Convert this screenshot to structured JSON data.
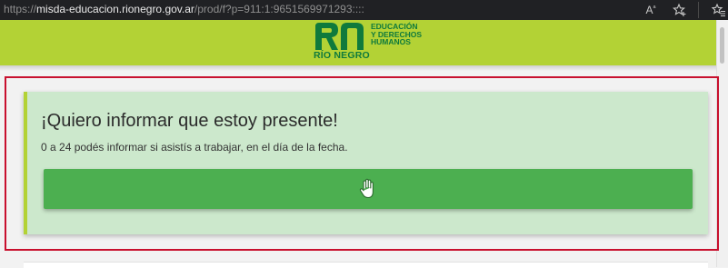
{
  "browser": {
    "url_prefix": "https://",
    "url_domain": "misda-educacion.rionegro.gov.ar",
    "url_path": "/prod/f?p=911:1:9651569971293::::",
    "icons": [
      "read-aloud-icon",
      "favorites-add-icon",
      "favorites-icon"
    ],
    "read_aloud_glyph": "A",
    "read_aloud_sup": "ᵃ"
  },
  "header": {
    "logo_mark": "RN",
    "logo_sub": "RÍO NEGRO",
    "logo_line1": "EDUCACIÓN",
    "logo_line2": "Y DERECHOS",
    "logo_line3": "HUMANOS",
    "background": "#b3d235",
    "brand_color": "#0f7a3c"
  },
  "card": {
    "title": "¡Quiero informar que estoy presente!",
    "description": "0 a 24 podés informar si asistís a trabajar, en el día de la fecha.",
    "button_icon": "hand-icon",
    "background": "#cce8cc",
    "button_color": "#4caf50"
  },
  "highlight": {
    "border_color": "#c8102e"
  }
}
